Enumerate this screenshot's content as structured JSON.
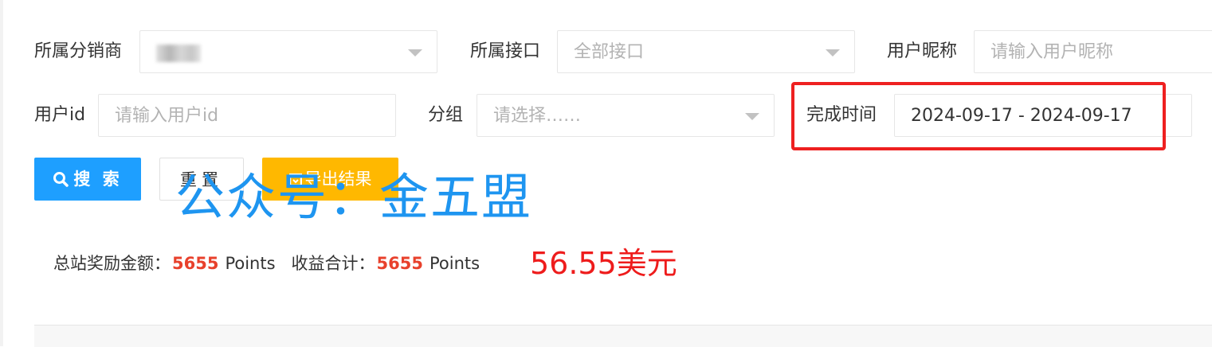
{
  "filters": {
    "distributor": {
      "label": "所属分销商",
      "value": ""
    },
    "interface": {
      "label": "所属接口",
      "placeholder": "全部接口"
    },
    "nickname": {
      "label": "用户昵称",
      "placeholder": "请输入用户昵称"
    },
    "user_id": {
      "label": "用户id",
      "placeholder": "请输入用户id"
    },
    "group": {
      "label": "分组",
      "placeholder": "请选择……"
    },
    "completion_time": {
      "label": "完成时间",
      "value": "2024-09-17 - 2024-09-17"
    }
  },
  "buttons": {
    "search": "搜 索",
    "reset": "重置",
    "export": "导出结果"
  },
  "summary": {
    "total_reward_label": "总站奖励金额：",
    "total_reward_value": "5655",
    "total_reward_unit": "Points",
    "income_label": "收益合计：",
    "income_value": "5655",
    "income_unit": "Points",
    "usd_amount": "56.55美元"
  },
  "watermark": "公众号：金五盟",
  "colors": {
    "primary": "#1e9fff",
    "warning": "#ffb800",
    "highlight": "#ee2020",
    "number": "#e8412c"
  }
}
